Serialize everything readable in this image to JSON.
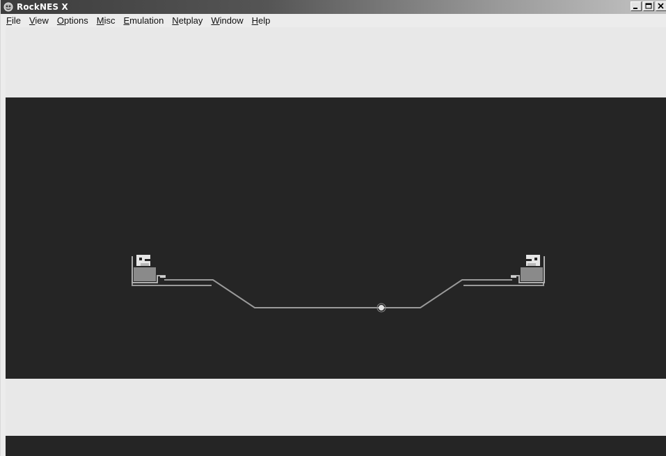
{
  "window": {
    "title": "RockNES X",
    "icon": "rocknes-app-icon",
    "controls": [
      "minimize-icon",
      "maximize-icon",
      "close-icon"
    ]
  },
  "menu": {
    "items": [
      {
        "label": "File",
        "accel": "F",
        "rest": "ile"
      },
      {
        "label": "View",
        "accel": "V",
        "rest": "iew"
      },
      {
        "label": "Options",
        "accel": "O",
        "rest": "ptions"
      },
      {
        "label": "Misc",
        "accel": "M",
        "rest": "isc"
      },
      {
        "label": "Emulation",
        "accel": "E",
        "rest": "mulation"
      },
      {
        "label": "Netplay",
        "accel": "N",
        "rest": "etplay"
      },
      {
        "label": "Window",
        "accel": "W",
        "rest": "indow"
      },
      {
        "label": "Help",
        "accel": "H",
        "rest": "elp"
      }
    ]
  },
  "colors": {
    "screen_bg": "#252525",
    "padding_bg": "#e8e8e8",
    "track": "#9a9a9a",
    "ball": "#e0e0e0"
  }
}
